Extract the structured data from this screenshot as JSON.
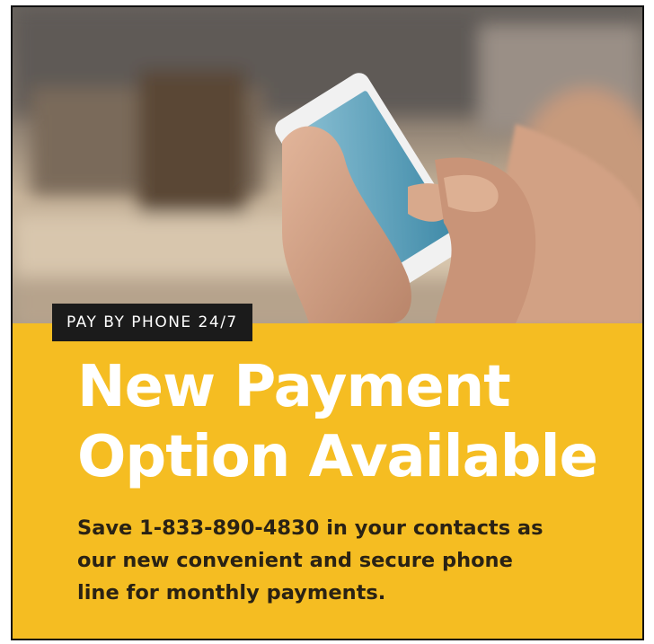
{
  "badge": {
    "label": "PAY BY PHONE 24/7"
  },
  "headline": {
    "line1": "New Payment",
    "line2": "Option Available"
  },
  "body": {
    "line1": "Save 1-833-890-4830 in your contacts as",
    "line2": "our new convenient and secure phone",
    "line3": "line for monthly payments."
  },
  "colors": {
    "accent_yellow": "#f5bd22",
    "badge_bg": "#1b1b1b",
    "headline_text": "#ffffff",
    "body_text": "#2a2214"
  }
}
